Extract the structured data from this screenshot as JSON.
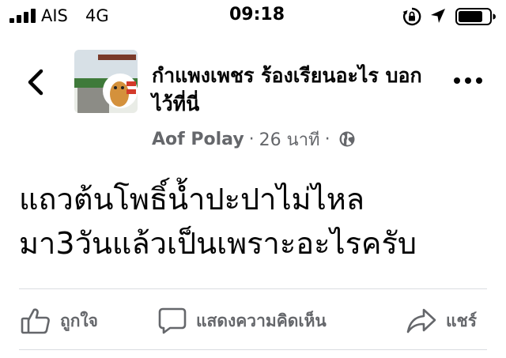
{
  "status_bar": {
    "carrier": "AIS",
    "network": "4G",
    "time": "09:18",
    "icons": [
      "signal-bars-icon",
      "rotation-lock-icon",
      "location-arrow-icon",
      "battery-icon"
    ]
  },
  "post": {
    "group_name": "กำแพงเพชร ร้องเรียนอะไร บอกไว้ที่นี่",
    "author": "Aof Polay",
    "time_ago": "26 นาที",
    "separator": "·",
    "privacy_icon": "globe-icon",
    "text_lines": [
      "แถวต้นโพธิ์น้ำปะปาไม่ไหล",
      "มา3วันแล้วเป็นเพราะอะไรครับ"
    ]
  },
  "actions": {
    "like_label": "ถูกใจ",
    "comment_label": "แสดงความคิดเห็น",
    "share_label": "แชร์"
  },
  "colors": {
    "primary_text": "#050505",
    "secondary_text": "#65676b",
    "divider": "#dadde1",
    "background": "#ffffff"
  }
}
